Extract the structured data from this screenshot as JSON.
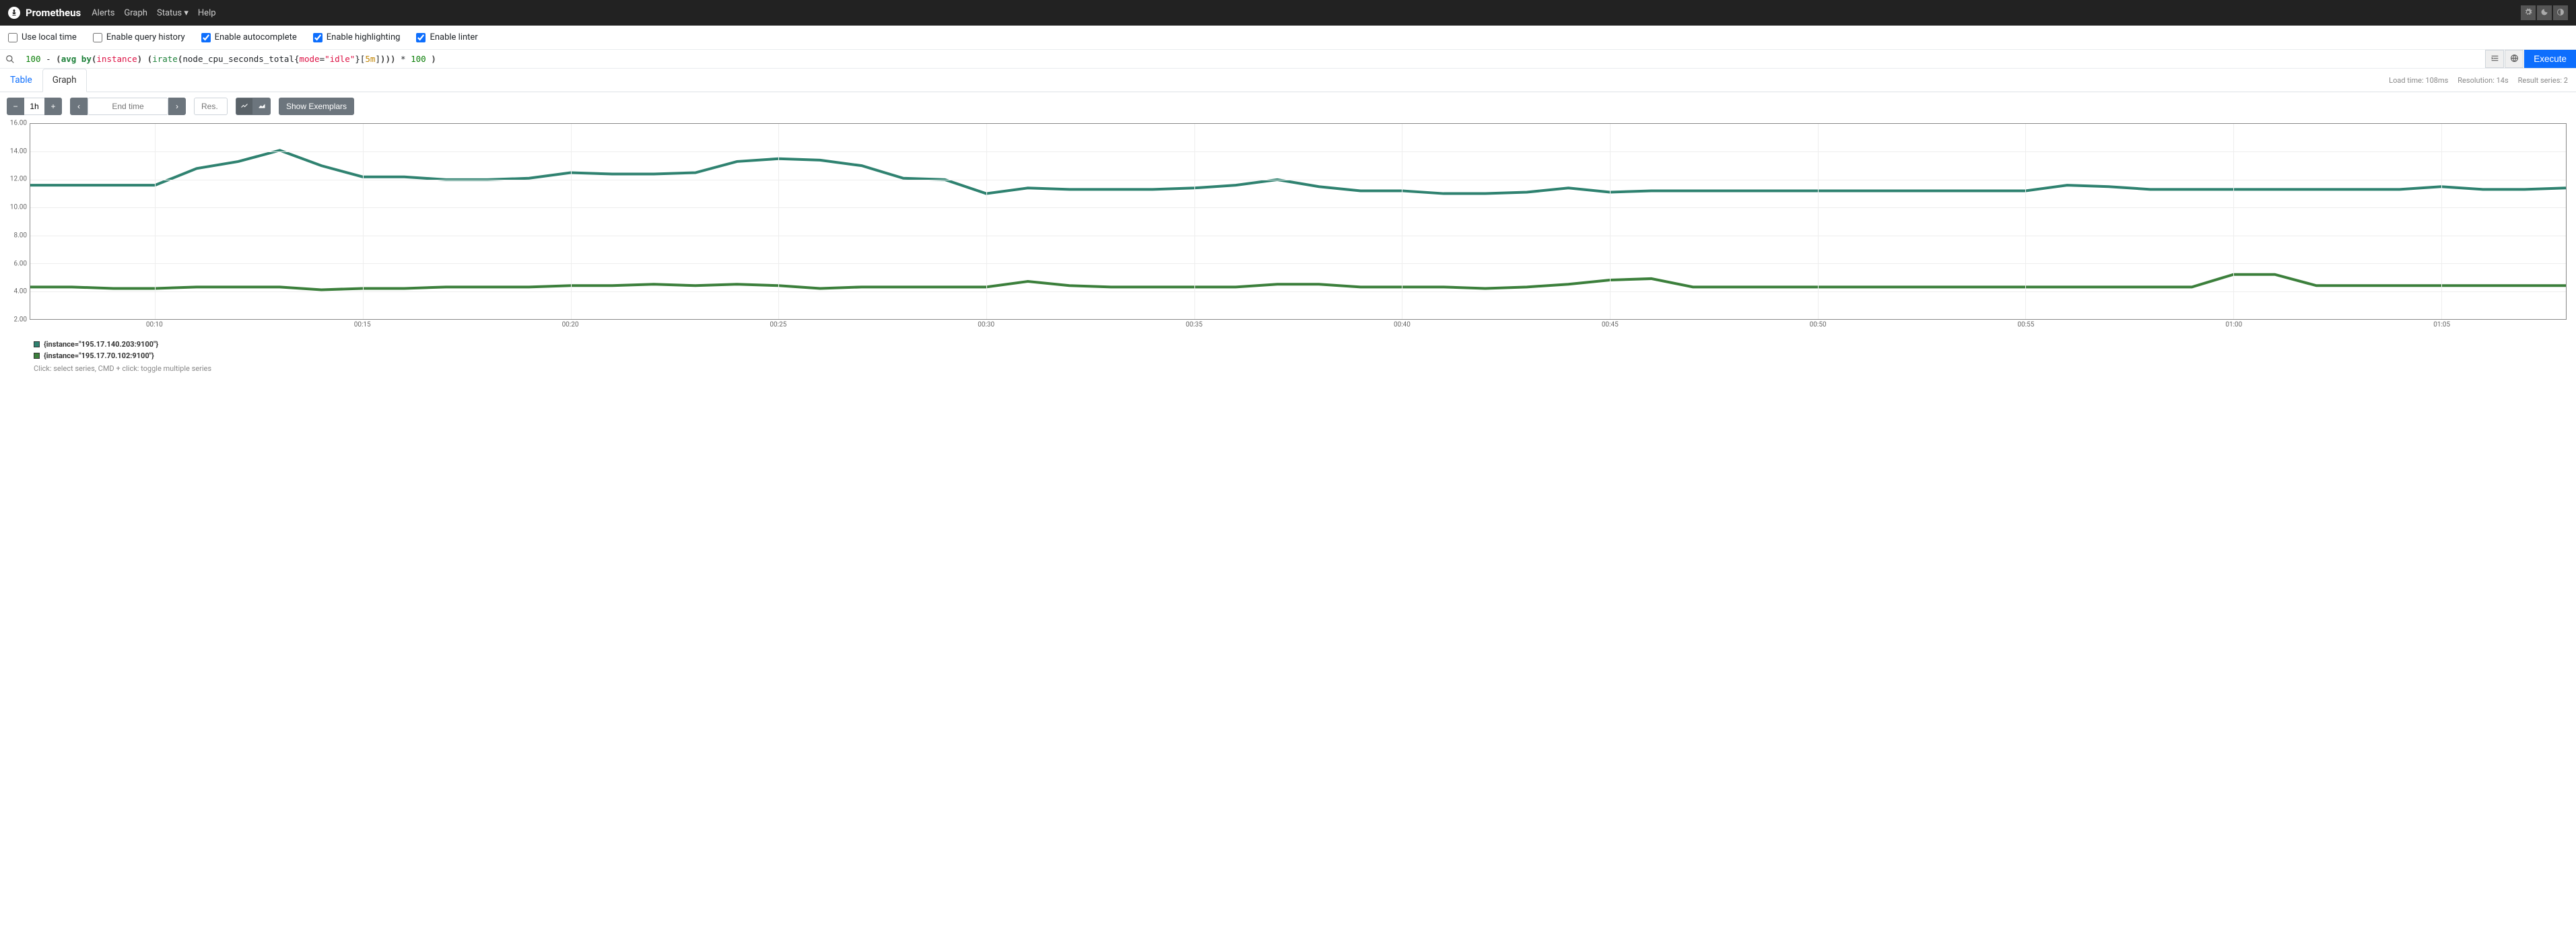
{
  "navbar": {
    "brand": "Prometheus",
    "links": [
      "Alerts",
      "Graph",
      "Status",
      "Help"
    ]
  },
  "options": [
    {
      "label": "Use local time",
      "checked": false
    },
    {
      "label": "Enable query history",
      "checked": false
    },
    {
      "label": "Enable autocomplete",
      "checked": true
    },
    {
      "label": "Enable highlighting",
      "checked": true
    },
    {
      "label": "Enable linter",
      "checked": true
    }
  ],
  "query": {
    "text": "100 - (avg by(instance) (irate(node_cpu_seconds_total{mode=\"idle\"}[5m])) * 100 )",
    "execute_label": "Execute"
  },
  "meta": {
    "load_time": "Load time: 108ms",
    "resolution": "Resolution: 14s",
    "series": "Result series: 2"
  },
  "tabs": {
    "table": "Table",
    "graph": "Graph",
    "active": "graph"
  },
  "controls": {
    "range": "1h",
    "end_time_placeholder": "End time",
    "res_placeholder": "Res. (s)",
    "show_exemplars": "Show Exemplars"
  },
  "legend": {
    "items": [
      {
        "label": "{instance=\"195.17.140.203:9100\"}",
        "color": "#2f8270"
      },
      {
        "label": "{instance=\"195.17.70.102:9100\"}",
        "color": "#3b7f3b"
      }
    ],
    "hint": "Click: select series, CMD + click: toggle multiple series"
  },
  "chart_data": {
    "type": "line",
    "ylim": [
      2,
      16
    ],
    "yticks": [
      2.0,
      4.0,
      6.0,
      8.0,
      10.0,
      12.0,
      14.0,
      16.0
    ],
    "xticks": [
      "00:10",
      "00:15",
      "00:20",
      "00:25",
      "00:30",
      "00:35",
      "00:40",
      "00:45",
      "00:50",
      "00:55",
      "01:00",
      "01:05"
    ],
    "x_range_minutes": [
      7,
      68
    ],
    "series": [
      {
        "name": "{instance=\"195.17.140.203:9100\"}",
        "color": "#2f8270",
        "x": [
          7,
          8,
          9,
          10,
          11,
          12,
          13,
          14,
          15,
          16,
          17,
          18,
          19,
          20,
          21,
          22,
          23,
          24,
          25,
          26,
          27,
          28,
          29,
          30,
          31,
          32,
          33,
          34,
          35,
          36,
          37,
          38,
          39,
          40,
          41,
          42,
          43,
          44,
          45,
          46,
          47,
          48,
          49,
          50,
          51,
          52,
          53,
          54,
          55,
          56,
          57,
          58,
          59,
          60,
          61,
          62,
          63,
          64,
          65,
          66,
          67,
          68
        ],
        "y": [
          11.6,
          11.6,
          11.6,
          11.6,
          12.8,
          13.3,
          14.1,
          13.0,
          12.2,
          12.2,
          12.0,
          12.0,
          12.1,
          12.5,
          12.4,
          12.4,
          12.5,
          13.3,
          13.5,
          13.4,
          13.0,
          12.1,
          12.0,
          11.0,
          11.4,
          11.3,
          11.3,
          11.3,
          11.4,
          11.6,
          12.0,
          11.5,
          11.2,
          11.2,
          11.0,
          11.0,
          11.1,
          11.4,
          11.1,
          11.2,
          11.2,
          11.2,
          11.2,
          11.2,
          11.2,
          11.2,
          11.2,
          11.2,
          11.2,
          11.6,
          11.5,
          11.3,
          11.3,
          11.3,
          11.3,
          11.3,
          11.3,
          11.3,
          11.5,
          11.3,
          11.3,
          11.4
        ]
      },
      {
        "name": "{instance=\"195.17.70.102:9100\"}",
        "color": "#3b7f3b",
        "x": [
          7,
          8,
          9,
          10,
          11,
          12,
          13,
          14,
          15,
          16,
          17,
          18,
          19,
          20,
          21,
          22,
          23,
          24,
          25,
          26,
          27,
          28,
          29,
          30,
          31,
          32,
          33,
          34,
          35,
          36,
          37,
          38,
          39,
          40,
          41,
          42,
          43,
          44,
          45,
          46,
          47,
          48,
          49,
          50,
          51,
          52,
          53,
          54,
          55,
          56,
          57,
          58,
          59,
          60,
          61,
          62,
          63,
          64,
          65,
          66,
          67,
          68
        ],
        "y": [
          4.3,
          4.3,
          4.2,
          4.2,
          4.3,
          4.3,
          4.3,
          4.1,
          4.2,
          4.2,
          4.3,
          4.3,
          4.3,
          4.4,
          4.4,
          4.5,
          4.4,
          4.5,
          4.4,
          4.2,
          4.3,
          4.3,
          4.3,
          4.3,
          4.7,
          4.4,
          4.3,
          4.3,
          4.3,
          4.3,
          4.5,
          4.5,
          4.3,
          4.3,
          4.3,
          4.2,
          4.3,
          4.5,
          4.8,
          4.9,
          4.3,
          4.3,
          4.3,
          4.3,
          4.3,
          4.3,
          4.3,
          4.3,
          4.3,
          4.3,
          4.3,
          4.3,
          4.3,
          5.2,
          5.2,
          4.4,
          4.4,
          4.4,
          4.4,
          4.4,
          4.4,
          4.4
        ]
      }
    ]
  }
}
